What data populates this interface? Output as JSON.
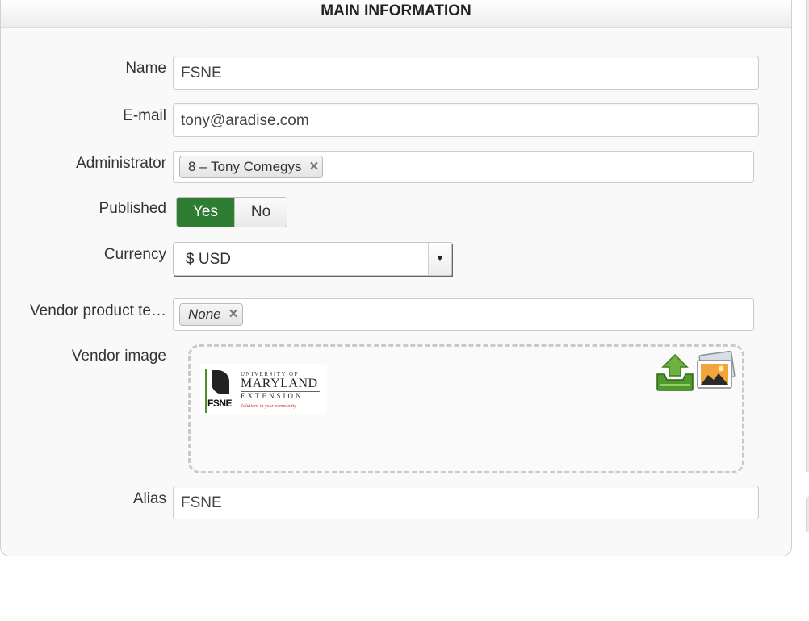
{
  "header": {
    "title": "MAIN INFORMATION"
  },
  "fields": {
    "name": {
      "label": "Name",
      "value": "FSNE"
    },
    "email": {
      "label": "E-mail",
      "value": "tony@aradise.com"
    },
    "administrator": {
      "label": "Administrator",
      "tag": "8 – Tony Comegys"
    },
    "published": {
      "label": "Published",
      "yes": "Yes",
      "no": "No",
      "selected": "Yes"
    },
    "currency": {
      "label": "Currency",
      "value": "$ USD"
    },
    "vendor_template": {
      "label": "Vendor product te…",
      "tag": "None"
    },
    "vendor_image": {
      "label": "Vendor image",
      "logo": {
        "mark": "FSNE",
        "line1": "UNIVERSITY OF",
        "line2": "MARYLAND",
        "line3": "EXTENSION",
        "tagline": "Solutions in your community"
      }
    },
    "alias": {
      "label": "Alias",
      "value": "FSNE"
    }
  },
  "icons": {
    "upload": "upload-tray-icon",
    "image": "image-gallery-icon",
    "remove": "close-icon",
    "dropdown": "caret-down-icon"
  },
  "colors": {
    "toggle_active": "#2f7d32",
    "tagline": "#c0392b"
  }
}
